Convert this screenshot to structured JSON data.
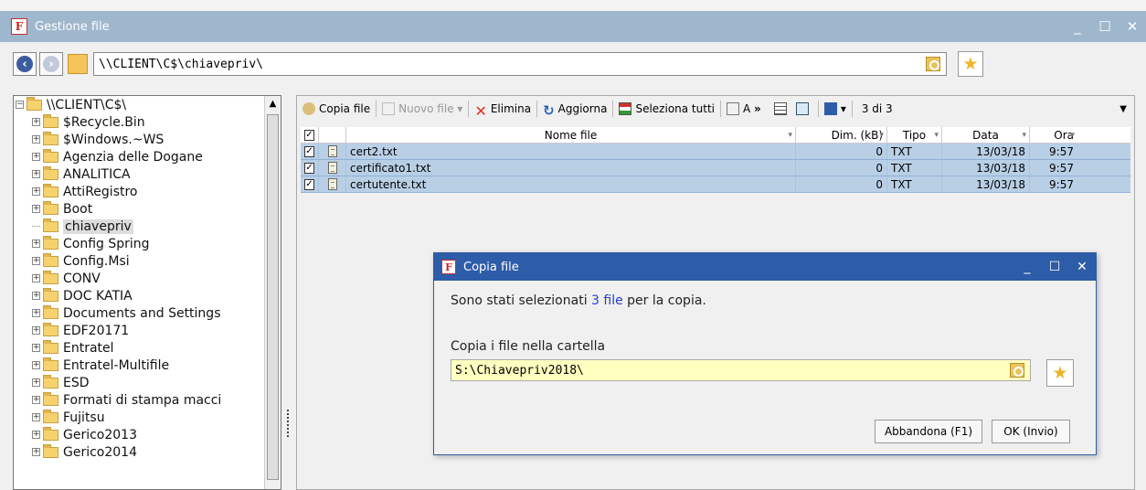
{
  "window": {
    "title": "Gestione file",
    "app_icon_letter": "F",
    "controls": [
      "_",
      "☐",
      "✕"
    ]
  },
  "address": {
    "path": "\\\\CLIENT\\C$\\chiavepriv\\"
  },
  "tree": {
    "root": "\\\\CLIENT\\C$\\",
    "items": [
      {
        "label": "$Recycle.Bin"
      },
      {
        "label": "$Windows.~WS"
      },
      {
        "label": "Agenzia delle Dogane"
      },
      {
        "label": "ANALITICA"
      },
      {
        "label": "AttiRegistro"
      },
      {
        "label": "Boot"
      },
      {
        "label": "chiavepriv",
        "selected": true
      },
      {
        "label": "Config Spring"
      },
      {
        "label": "Config.Msi"
      },
      {
        "label": "CONV"
      },
      {
        "label": "DOC KATIA"
      },
      {
        "label": "Documents and Settings"
      },
      {
        "label": "EDF20171"
      },
      {
        "label": "Entratel"
      },
      {
        "label": "Entratel-Multifile"
      },
      {
        "label": "ESD"
      },
      {
        "label": "Formati di stampa macci"
      },
      {
        "label": "Fujitsu"
      },
      {
        "label": "Gerico2013"
      },
      {
        "label": "Gerico2014"
      }
    ]
  },
  "toolbar": {
    "copy": "Copia file",
    "new_file": "Nuovo file",
    "delete": "Elimina",
    "refresh": "Aggiorna",
    "select_all": "Seleziona tutti",
    "view_label": "A",
    "more": "»",
    "counter": "3 di 3"
  },
  "table": {
    "headers": {
      "name": "Nome file",
      "size": "Dim. (kB)",
      "type": "Tipo",
      "date": "Data",
      "time": "Ora"
    },
    "rows": [
      {
        "name": "cert2.txt",
        "size": "0",
        "type": "TXT",
        "date": "13/03/18",
        "time": "9:57",
        "checked": true
      },
      {
        "name": "certificato1.txt",
        "size": "0",
        "type": "TXT",
        "date": "13/03/18",
        "time": "9:57",
        "checked": true
      },
      {
        "name": "certutente.txt",
        "size": "0",
        "type": "TXT",
        "date": "13/03/18",
        "time": "9:57",
        "checked": true
      }
    ]
  },
  "dialog": {
    "title": "Copia file",
    "msg_pre": "Sono stati selezionati ",
    "msg_highlight": "3 file",
    "msg_post": " per la copia.",
    "dest_label": "Copia i file nella cartella",
    "dest_value": "S:\\Chiavepriv2018\\",
    "abort_button": "Abbandona (F1)",
    "ok_button": "OK (Invio)"
  },
  "colors": {
    "titlebar": "#9fb7cd",
    "dialog_titlebar": "#2d5ca8",
    "row_selected": "#b9cfe6",
    "input_highlight": "#ffffc0"
  }
}
